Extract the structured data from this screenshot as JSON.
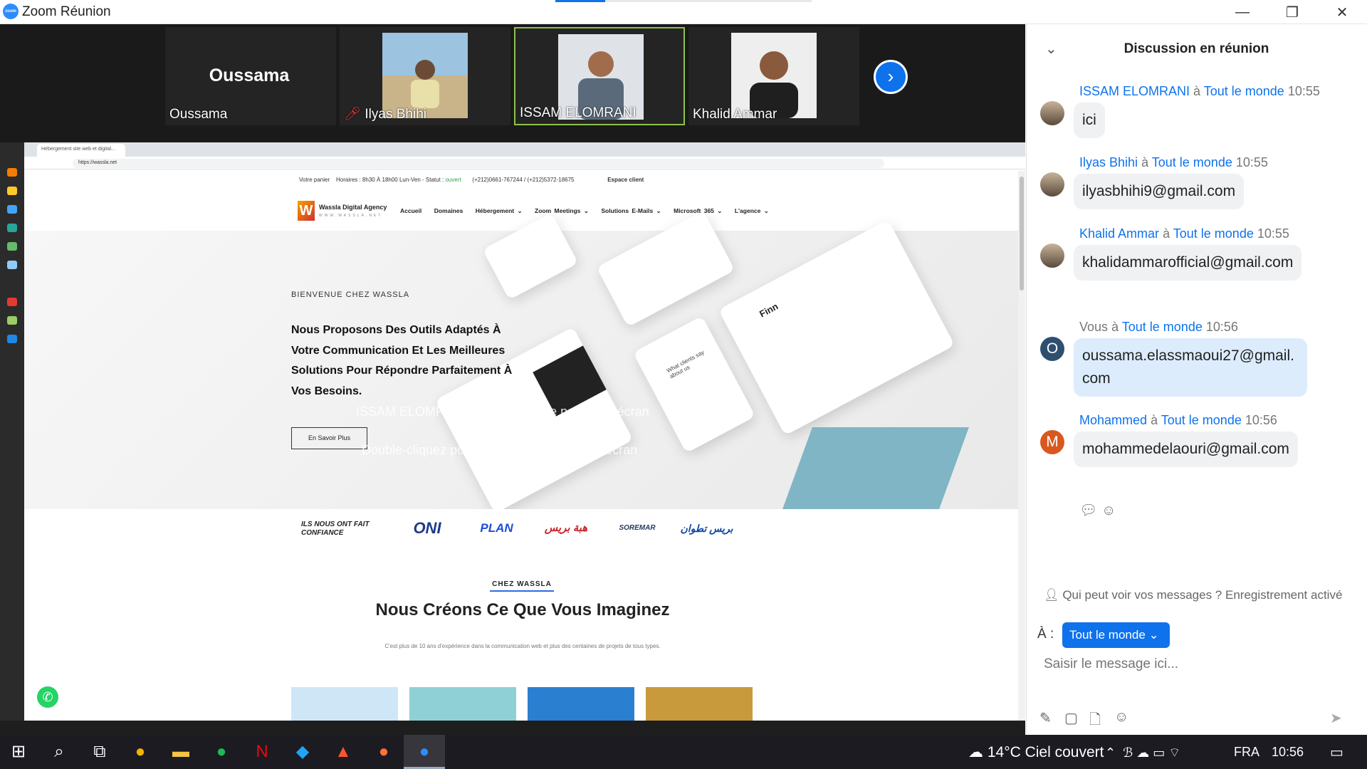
{
  "window": {
    "title": "Zoom Réunion",
    "logo_text": "zoom",
    "minimize": "—",
    "restore": "❐",
    "close": "✕"
  },
  "participants": {
    "tiles": [
      {
        "name": "Oussama",
        "big_name": "Oussama",
        "muted": false
      },
      {
        "name": "Ilyas Bhihi",
        "muted": true
      },
      {
        "name": "ISSAM ELOMRANI",
        "active": true
      },
      {
        "name": "Khalid Ammar"
      }
    ],
    "next_icon": "chevron-right-icon"
  },
  "browser": {
    "tab_title": "Hébergement site web et digital...",
    "url": "https://wassla.net"
  },
  "website": {
    "topbar": {
      "cart": "Votre panier",
      "hours": "Horaires : 8h30 À 18h00 Lun-Ven - Statut :",
      "status": "ouvert",
      "phones": "(+212)0661-767244 / (+212)5372-18675",
      "client_space": "Espace client"
    },
    "logo": {
      "letter": "W",
      "name": "Wassla Digital Agency",
      "tagline": "WWW.WASSLA.NET"
    },
    "nav": [
      "Accueil",
      "Domaines",
      "Hébergement ⌄",
      "Zoom Meetings ⌄",
      "Solutions E-Mails ⌄",
      "Microsoft 365 ⌄",
      "L'agence ⌄"
    ],
    "hero": {
      "welcome": "BIENVENUE CHEZ WASSLA",
      "headline": "Nous Proposons Des Outils Adaptés À Votre Communication Et Les Meilleures Solutions Pour Répondre Parfaitement À Vos Besoins.",
      "button": "En Savoir Plus",
      "mock_title": "Finn",
      "mock_card": "What clients say about us"
    },
    "overlay": {
      "line1": "ISSAM ELOMRANI a commencé le partage d'écran",
      "line2": "Double-cliquez pour passer en mode plein écran"
    },
    "trust": {
      "label": "ILS NOUS ONT FAIT CONFIANCE",
      "logos": [
        "ONI",
        "PLAN",
        "هبة بريس",
        "SOREMAR",
        "بريس تطوان"
      ]
    },
    "section": {
      "kicker": "CHEZ WASSLA",
      "title": "Nous Créons Ce Que Vous Imaginez",
      "subtitle": "C'est plus de 10 ans d'expérience dans la communication web et plus des centaines de projets de tous types."
    },
    "whatsapp_icon": "whatsapp-icon"
  },
  "chat": {
    "title": "Discussion en réunion",
    "to_word": "à",
    "messages": [
      {
        "sender": "ISSAM ELOMRANI",
        "to": "Tout le monde",
        "time": "10:55",
        "text": "ici",
        "avatar": "photo"
      },
      {
        "sender": "Ilyas Bhihi",
        "to": "Tout le monde",
        "time": "10:55",
        "text": "ilyasbhihi9@gmail.com",
        "avatar": "photo"
      },
      {
        "sender": "Khalid Ammar",
        "to": "Tout le monde",
        "time": "10:55",
        "text": "khalidammarofficial@gmail.com",
        "avatar": "photo"
      },
      {
        "sender": "Vous",
        "to": "Tout le monde",
        "time": "10:56",
        "text": "oussama.elassmaoui27@gmail.com",
        "avatar": "O",
        "avatar_color": "#2f4f6f",
        "me": true
      },
      {
        "sender": "Mohammed",
        "to": "Tout le monde",
        "time": "10:56",
        "text": "mohammedelaouri@gmail.com",
        "avatar": "M",
        "avatar_color": "#d9581f"
      }
    ],
    "who_can_see": "Qui peut voir vos messages ? Enregistrement activé",
    "to_label": "À :",
    "recipient": "Tout le monde",
    "input_placeholder": "Saisir le message ici..."
  },
  "taskbar": {
    "weather": "14°C  Ciel couvert",
    "language": "FRA",
    "time": "10:56",
    "apps": [
      "windows-icon",
      "search-icon",
      "task-view-icon",
      "chrome-icon",
      "file-explorer-icon",
      "spotify-icon",
      "netflix-icon",
      "vscode-icon",
      "brave-icon",
      "firefox-icon",
      "zoom-icon"
    ]
  },
  "colors": {
    "zoom_blue": "#0e72ed",
    "active_border": "#8bc34a",
    "chat_me_bubble": "#dcecfd"
  }
}
